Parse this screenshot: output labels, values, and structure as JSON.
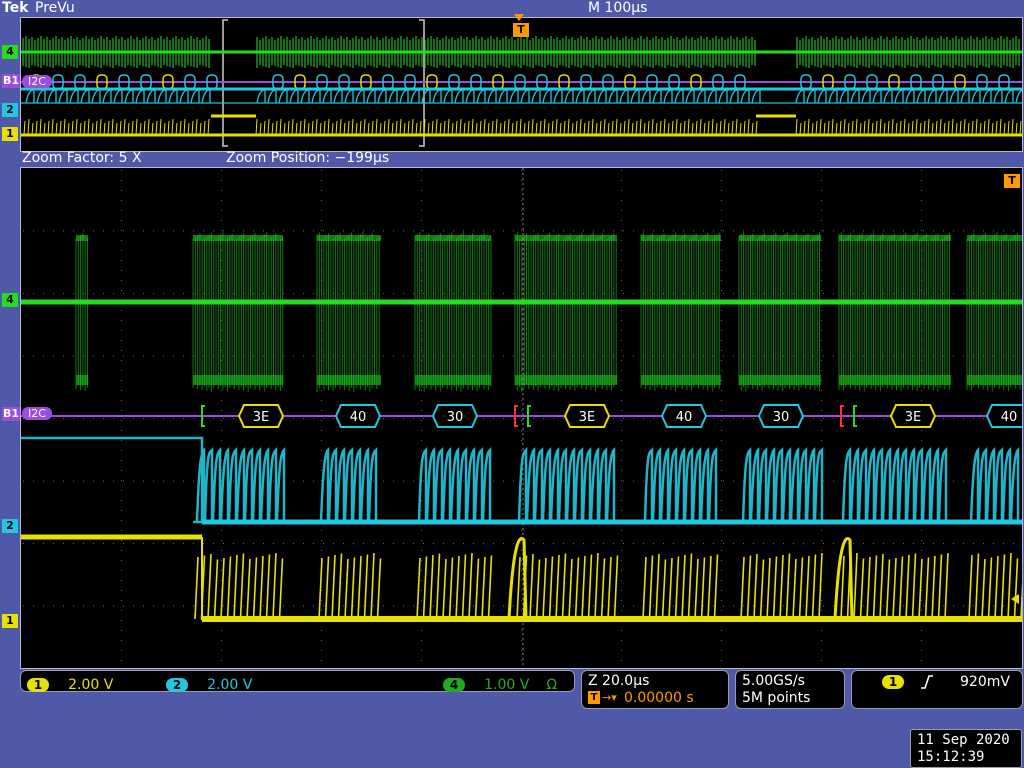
{
  "header": {
    "brand": "Tek",
    "mode": "PreVu",
    "timebase": "M 100µs",
    "trigger_marker": "T"
  },
  "zoom_info": {
    "factor": "Zoom Factor: 5 X",
    "position": "Zoom Position: −199µs"
  },
  "channels": {
    "ch4": {
      "id": "4",
      "color": "#22dd22"
    },
    "b1": {
      "id": "B1",
      "label": "I2C",
      "color": "#9a4ddf"
    },
    "ch2": {
      "id": "2",
      "color": "#22c8e0"
    },
    "ch1": {
      "id": "1",
      "color": "#e8e000"
    }
  },
  "trigger_right_marker": "T",
  "bus_packets": [
    "3E",
    "40",
    "30",
    "3E",
    "40",
    "30",
    "3E",
    "40"
  ],
  "status": {
    "ch1_scale": "2.00 V",
    "ch2_scale": "2.00 V",
    "ch4_scale": "1.00 V",
    "ch4_term": "Ω",
    "zoom_scale": "Z 20.0µs",
    "trig_pos": "0.00000 s",
    "sample_rate": "5.00GS/s",
    "record_length": "5M points",
    "trig_source": "1",
    "trig_level": "920mV",
    "date": "11 Sep  2020",
    "time": "15:12:39"
  }
}
